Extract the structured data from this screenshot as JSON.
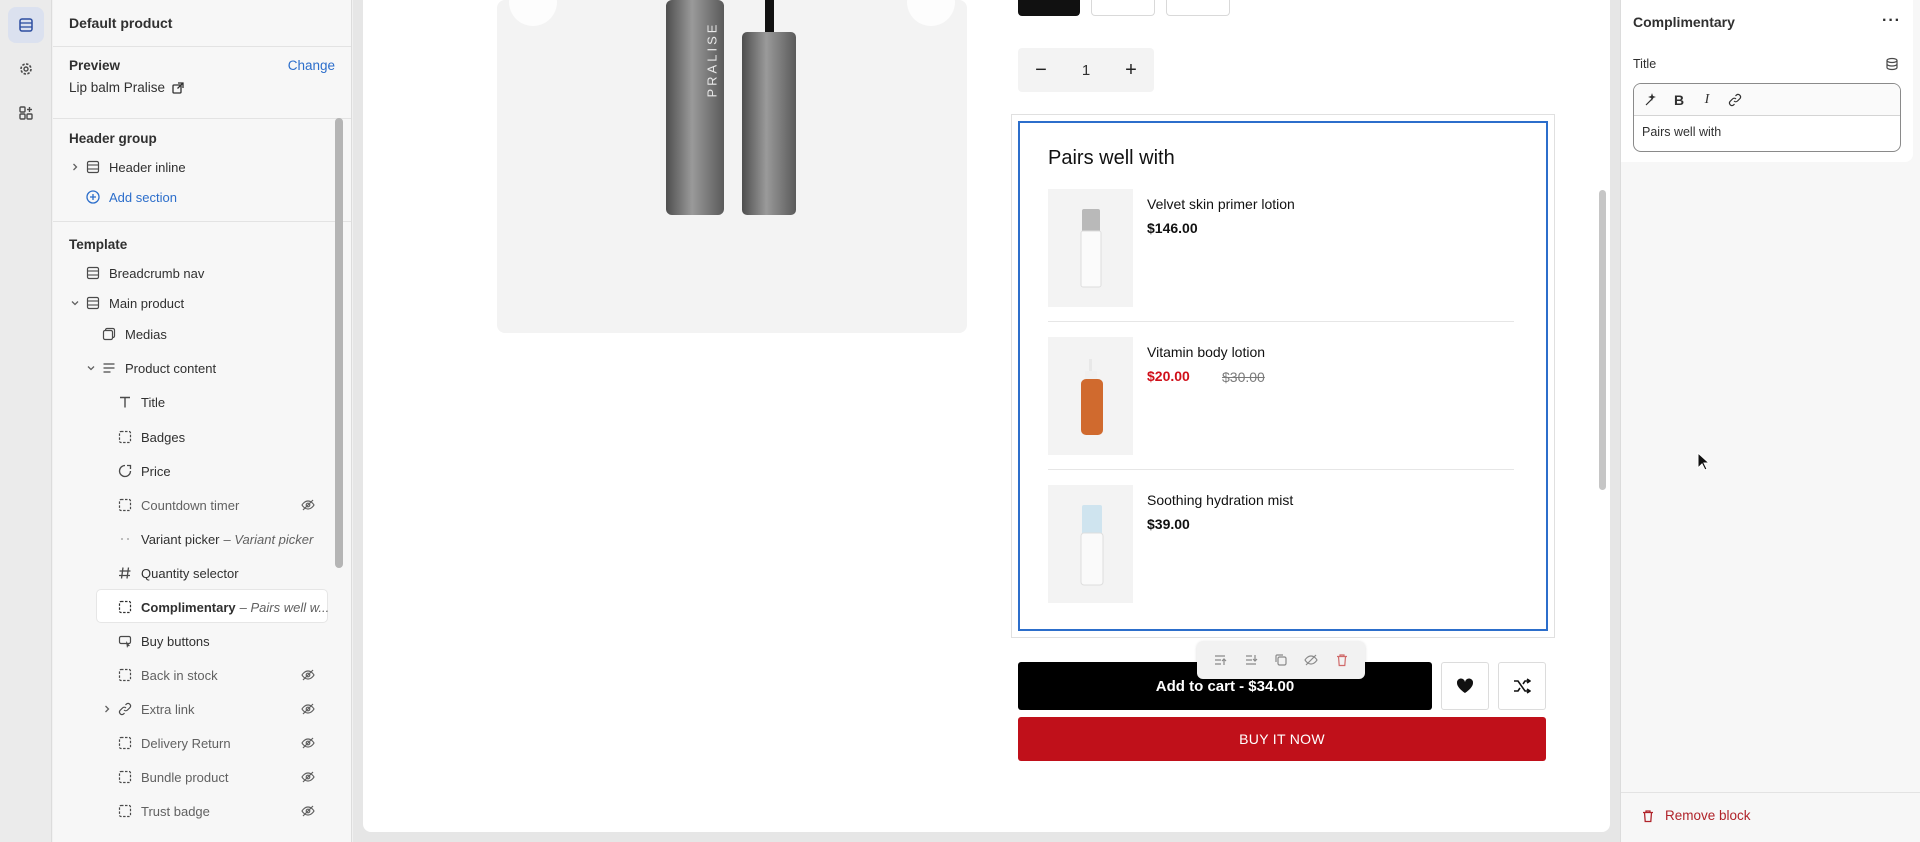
{
  "sidebar": {
    "title": "Default product",
    "preview_label": "Preview",
    "change_label": "Change",
    "preview_value": "Lip balm Pralise",
    "header_group_title": "Header group",
    "header_inline": "Header inline",
    "add_section": "Add section",
    "template_title": "Template",
    "items": {
      "breadcrumb": "Breadcrumb nav",
      "main_product": "Main product",
      "medias": "Medias",
      "product_content": "Product content",
      "title": "Title",
      "badges": "Badges",
      "price": "Price",
      "countdown": "Countdown timer",
      "variant": "Variant picker",
      "variant_sub": "– Variant picker",
      "quantity": "Quantity selector",
      "complimentary": "Complimentary",
      "complimentary_sub": "– Pairs well w...",
      "buy_buttons": "Buy buttons",
      "back_in_stock": "Back in stock",
      "extra_link": "Extra link",
      "delivery_return": "Delivery Return",
      "bundle_product": "Bundle product",
      "trust_badge": "Trust badge"
    }
  },
  "canvas": {
    "gallery_brand": "PRALISE",
    "quantity_value": "1",
    "complementary": {
      "title": "Pairs well with",
      "products": [
        {
          "name": "Velvet skin primer lotion",
          "price": "$146.00"
        },
        {
          "name": "Vitamin body lotion",
          "price": "$20.00",
          "compare_price": "$30.00"
        },
        {
          "name": "Soothing hydration mist",
          "price": "$39.00"
        }
      ]
    },
    "add_to_cart": "Add to cart - $34.00",
    "buy_now": "BUY IT NOW"
  },
  "right_panel": {
    "title": "Complimentary",
    "more": "···",
    "field_label": "Title",
    "rte_value": "Pairs well with",
    "remove_block": "Remove block"
  },
  "colors": {
    "accent": "#2c6ecb",
    "sale": "#d0101a",
    "buy_now": "#c0101a",
    "remove": "#b0232a"
  }
}
